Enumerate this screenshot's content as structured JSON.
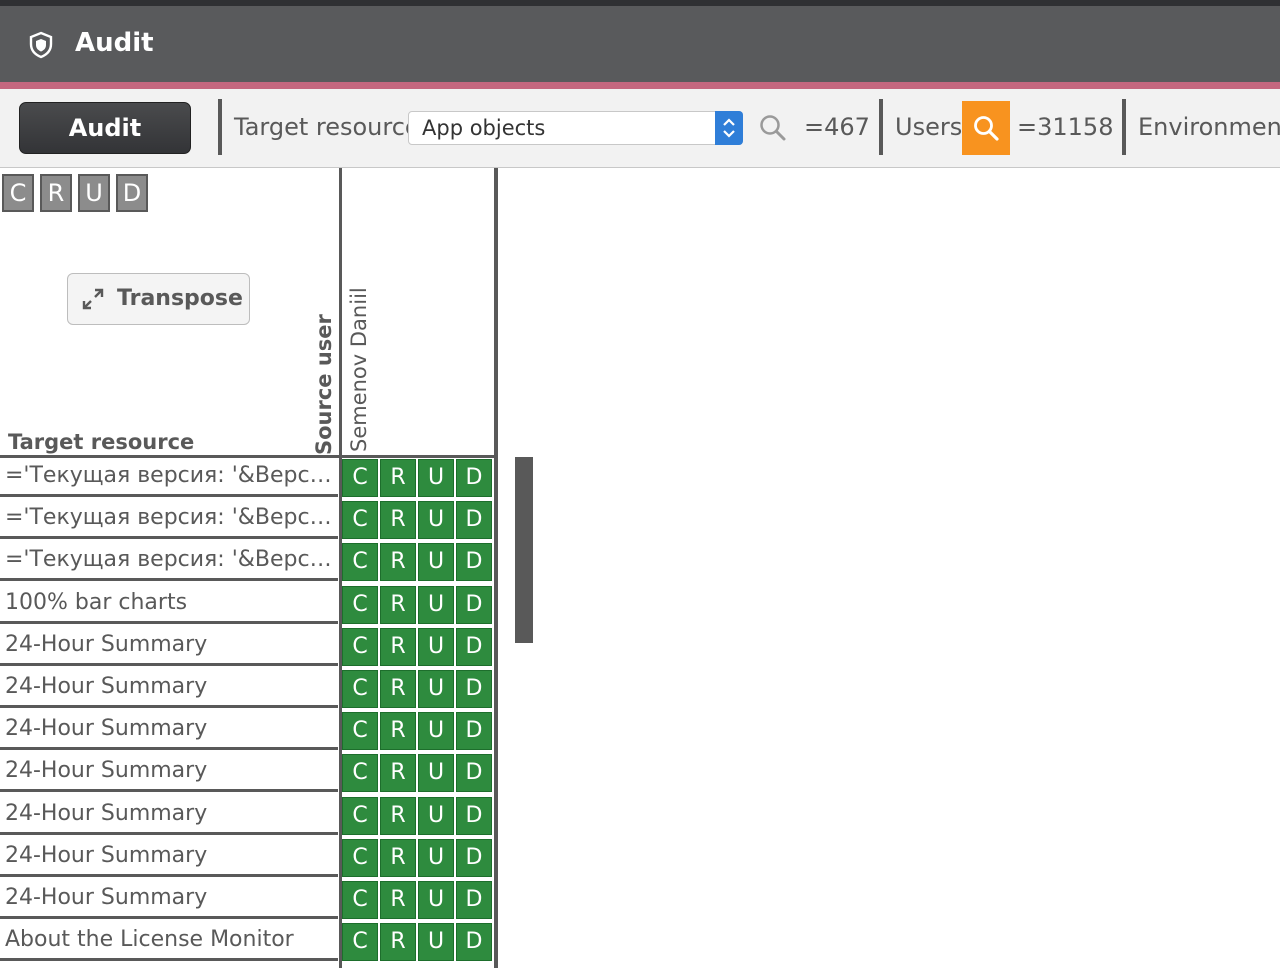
{
  "app": {
    "title": "Audit"
  },
  "toolbar": {
    "audit_button": "Audit",
    "target_resource_label": "Target resource",
    "target_resource_value": "App objects",
    "target_count": "=467",
    "users_label": "Users",
    "users_count": "=31158",
    "environment_label": "Environment"
  },
  "legend": {
    "letters": [
      "C",
      "R",
      "U",
      "D"
    ]
  },
  "transpose_button": "Transpose",
  "table": {
    "row_header": "Target resource",
    "column_header": "Source user",
    "columns": [
      "Semenov Daniil"
    ],
    "rows": [
      "='Текущая версия: '&Верси...",
      "='Текущая версия: '&Верси...",
      "='Текущая версия: '&Верси...",
      "100% bar charts",
      "24-Hour Summary",
      "24-Hour Summary",
      "24-Hour Summary",
      "24-Hour Summary",
      "24-Hour Summary",
      "24-Hour Summary",
      "24-Hour Summary",
      "About the License Monitor"
    ]
  },
  "icons": {
    "header": "shield-icon",
    "select_arrow": "chevron-updown-icon",
    "search": "search-icon",
    "users_search": "search-icon",
    "transpose": "expand-arrows-icon"
  },
  "colors": {
    "header_bg": "#595a5c",
    "accent": "#c5677f",
    "cell_green": "#2e8b3e",
    "search_orange": "#f8931f",
    "select_blue": "#2f7ed8"
  }
}
